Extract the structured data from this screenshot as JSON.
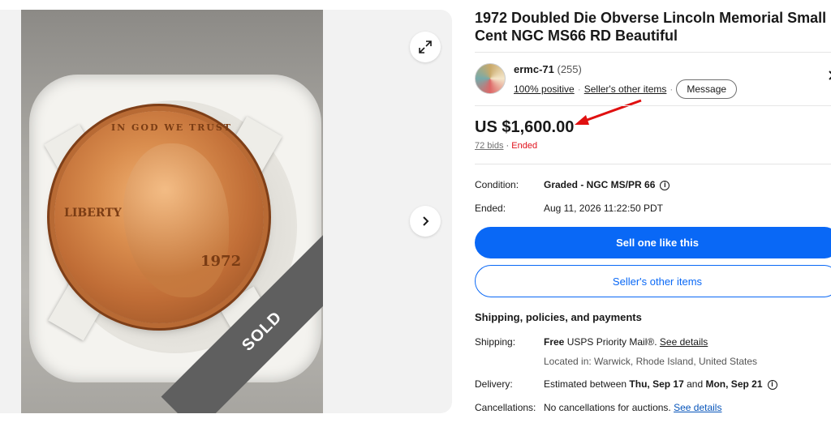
{
  "title": "1972 Doubled Die Obverse Lincoln Memorial Small Cent NGC MS66 RD Beautiful",
  "gallery": {
    "sold_label": "SOLD",
    "coin_liberty": "LIBERTY",
    "coin_year": "1972",
    "coin_motto": "IN GOD WE TRUST"
  },
  "seller": {
    "name": "ermc-71",
    "feedback_count": "(255)",
    "positive": "100% positive",
    "other_items_link": "Seller's other items",
    "message_button": "Message"
  },
  "price": {
    "amount": "US $1,600.00",
    "bids": "72 bids",
    "separator": "·",
    "status": "Ended"
  },
  "details": {
    "condition_label": "Condition:",
    "condition_value": "Graded - NGC MS/PR 66",
    "ended_label": "Ended:",
    "ended_value": "Aug 11, 2026 11:22:50 PDT"
  },
  "buttons": {
    "sell_one": "Sell one like this",
    "sellers_other": "Seller's other items"
  },
  "shipping": {
    "section_title": "Shipping, policies, and payments",
    "shipping_label": "Shipping:",
    "shipping_free": "Free",
    "shipping_method": "USPS Priority Mail®.",
    "see_details": "See details",
    "location": "Located in: Warwick, Rhode Island, United States",
    "delivery_label": "Delivery:",
    "delivery_prefix": "Estimated between",
    "delivery_start": "Thu, Sep 17",
    "delivery_and": "and",
    "delivery_end": "Mon, Sep 21",
    "cancellations_label": "Cancellations:",
    "cancellations_value": "No cancellations for auctions.",
    "cancellations_link": "See details"
  },
  "colors": {
    "primary_blue": "#0968f6",
    "ended_red": "#e0111b",
    "annotation_arrow": "#e01010"
  },
  "icons": {
    "expand": "expand-icon",
    "next": "chevron-right-icon",
    "info": "info-icon",
    "seller_chevron": "chevron-right-icon"
  }
}
